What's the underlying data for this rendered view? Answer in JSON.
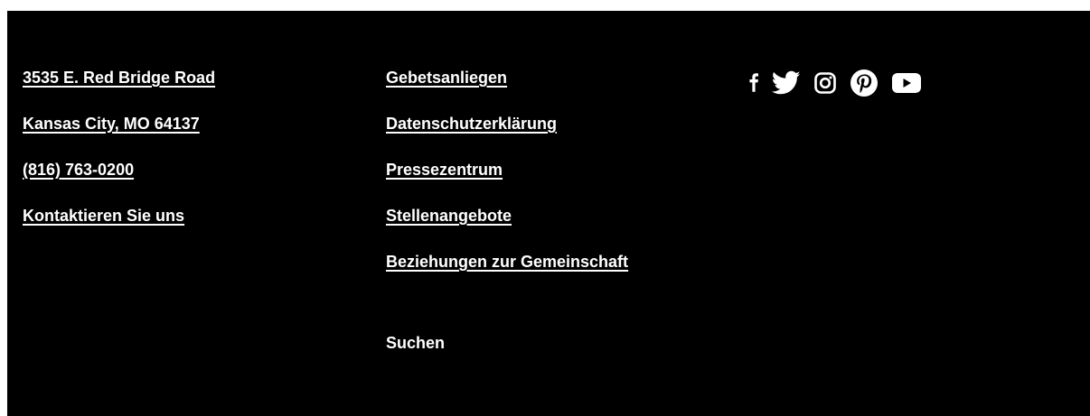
{
  "address": {
    "street": "3535 E. Red Bridge Road",
    "city": "Kansas City, MO 64137",
    "phone": "(816) 763-0200",
    "contact": "Kontaktieren Sie uns"
  },
  "links": [
    "Gebetsanliegen",
    "Datenschutzerklärung",
    "Pressezentrum",
    "Stellenangebote",
    "Beziehungen zur Gemeinschaft"
  ],
  "search_label": "Suchen",
  "social_icons": [
    "facebook-icon",
    "twitter-icon",
    "instagram-icon",
    "pinterest-icon",
    "youtube-icon"
  ],
  "colors": {
    "background": "#000000",
    "text": "#ffffff"
  }
}
